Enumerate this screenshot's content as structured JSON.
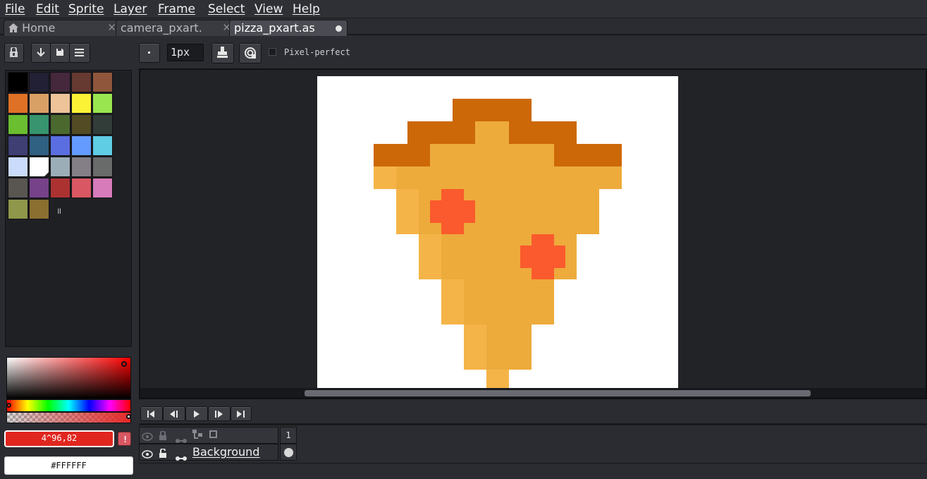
{
  "menu": {
    "file": "File",
    "edit": "Edit",
    "sprite": "Sprite",
    "layer": "Layer",
    "frame": "Frame",
    "select": "Select",
    "view": "View",
    "help": "Help"
  },
  "tabs": [
    {
      "label": "Home"
    },
    {
      "label": "camera_pxart."
    },
    {
      "label": "pizza_pxart.as"
    }
  ],
  "toolbar": {
    "brush_size": "1px",
    "pixel_perfect_label": "Pixel-perfect",
    "pixel_perfect_checked": false
  },
  "palette": {
    "colors": [
      "#000000",
      "#222034",
      "#45283c",
      "#663931",
      "#8f563b",
      "#df7126",
      "#d9a066",
      "#eec39a",
      "#fbf236",
      "#99e550",
      "#6abe30",
      "#37946e",
      "#4b692f",
      "#524b24",
      "#323c39",
      "#3f3f74",
      "#306082",
      "#5b6ee1",
      "#639bff",
      "#5fcde4",
      "#cbdbfc",
      "#ffffff",
      "#9badb7",
      "#847e87",
      "#696a6a",
      "#595652",
      "#76428a",
      "#ac3232",
      "#d95763",
      "#d77bba",
      "#8f974a",
      "#8a6f30"
    ],
    "selected_index": 21,
    "resize_glyph": "॥"
  },
  "colors": {
    "foreground_label": "4^96,82",
    "foreground_hex": "#e0261f",
    "background_label": "#FFFFFF",
    "background_hex": "#ffffff"
  },
  "pizza": {
    "crust": "#cc6808",
    "cheese": "#edab3c",
    "cheese_light": "#f5b447",
    "pepperoni": "#fa5a2d"
  },
  "timeline": {
    "frame_number": "1",
    "layer_name": "Background"
  },
  "icons": {
    "home": "home-icon",
    "close": "close-icon",
    "lock": "lock-icon",
    "eye": "eye-icon",
    "link": "link-icon"
  }
}
